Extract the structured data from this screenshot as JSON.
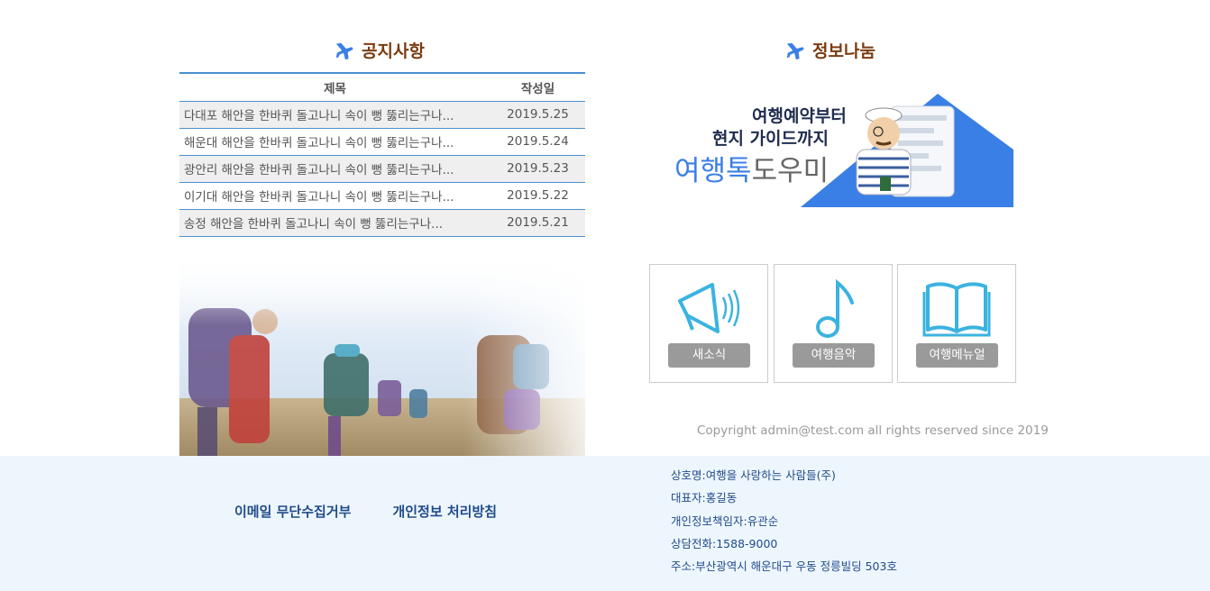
{
  "notice": {
    "title": "공지사항",
    "col_title": "제목",
    "col_date": "작성일",
    "rows": [
      {
        "title": "다대포 해안을 한바퀴 돌고나니 속이 뻥 뚫리는구나...",
        "date": "2019.5.25"
      },
      {
        "title": "해운대 해안을 한바퀴 돌고나니 속이 뻥 뚫리는구나...",
        "date": "2019.5.24"
      },
      {
        "title": "광안리 해안을 한바퀴 돌고나니 속이 뻥 뚫리는구나...",
        "date": "2019.5.23"
      },
      {
        "title": "이기대 해안을 한바퀴 돌고나니 속이 뻥 뚫리는구나...",
        "date": "2019.5.22"
      },
      {
        "title": "송정 해안을 한바퀴 돌고나니 속이 뻥 뚫리는구나...",
        "date": "2019.5.21"
      }
    ]
  },
  "info": {
    "title": "정보나눔",
    "banner": {
      "line1": "여행예약부터",
      "line2": "현지 가이드까지",
      "brand_a": "여행톡",
      "brand_b": "도우미"
    },
    "tiles": [
      {
        "label": "새소식",
        "icon": "megaphone-icon"
      },
      {
        "label": "여행음악",
        "icon": "music-note-icon"
      },
      {
        "label": "여행메뉴얼",
        "icon": "open-book-icon"
      }
    ]
  },
  "copyright": "Copyright admin@test.com all rights reserved since 2019",
  "footer": {
    "link_email": "이메일 무단수집거부",
    "link_privacy": "개인정보 처리방침",
    "company": "상호명:여행을 사랑하는 사람들(주)",
    "ceo": "대표자:홍길동",
    "privacy_officer": "개인정보책임자:유관순",
    "phone": "상담전화:1588-9000",
    "address": "주소:부산광역시 해운대구 우동 정릉빌딩 503호"
  },
  "colors": {
    "accent": "#3a7fe5",
    "heading": "#7a3b10",
    "table_line": "#4a8fd0",
    "footer_bg": "#eef6fd",
    "footer_text": "#1f4b8a",
    "tile_label": "#9a9a9a",
    "icon": "#3bb3e0"
  }
}
